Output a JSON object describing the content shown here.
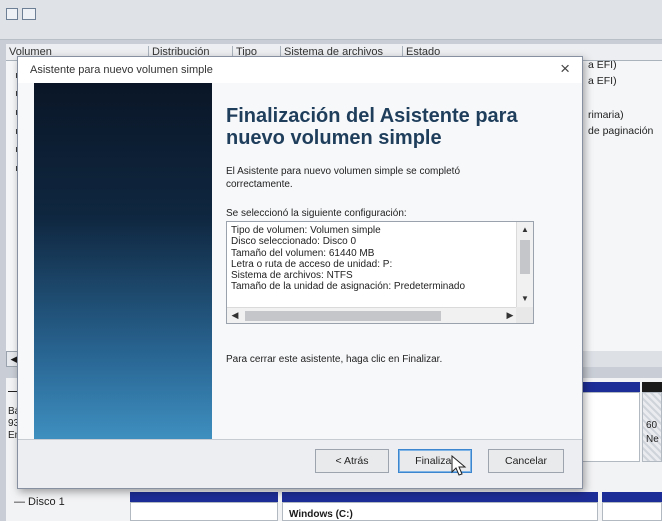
{
  "columns": {
    "volume": "Volumen",
    "layout": "Distribución",
    "type": "Tipo",
    "filesystem": "Sistema de archivos",
    "status": "Estado"
  },
  "right_column_texts": [
    "a EFI)",
    "a EFI)",
    "rimaria)",
    "de paginación"
  ],
  "disk_area": {
    "partial_labels": [
      "Bá",
      "93",
      "En"
    ],
    "right_labels": [
      "60",
      "Ne"
    ],
    "disk1_label": "— Disco 1",
    "partial_volume": "Windows (C:)"
  },
  "wizard": {
    "window_title": "Asistente para nuevo volumen simple",
    "close_glyph": "×",
    "heading": "Finalización del Asistente para nuevo volumen simple",
    "completed_text": "El Asistente para nuevo volumen simple se completó correctamente.",
    "config_label": "Se seleccionó la siguiente configuración:",
    "config_lines": [
      "Tipo de volumen: Volumen simple",
      "Disco seleccionado: Disco 0",
      "Tamaño del volumen: 61440 MB",
      "Letra o ruta de acceso de unidad: P:",
      "Sistema de archivos: NTFS",
      "Tamaño de la unidad de asignación: Predeterminado"
    ],
    "close_hint": "Para cerrar este asistente, haga clic en Finalizar.",
    "buttons": {
      "back": "< Atrás",
      "finish": "Finalizar",
      "cancel": "Cancelar"
    }
  },
  "icons": [
    "close-icon",
    "scroll-up-icon",
    "scroll-down-icon",
    "scroll-left-icon",
    "scroll-right-icon",
    "mouse-cursor-icon"
  ],
  "colors": {
    "wizard_heading": "#1f3e5c",
    "disk_bar_blue": "#1d2d97",
    "sidebar_dark": "#0a1627",
    "sidebar_light": "#3e8fbf"
  }
}
